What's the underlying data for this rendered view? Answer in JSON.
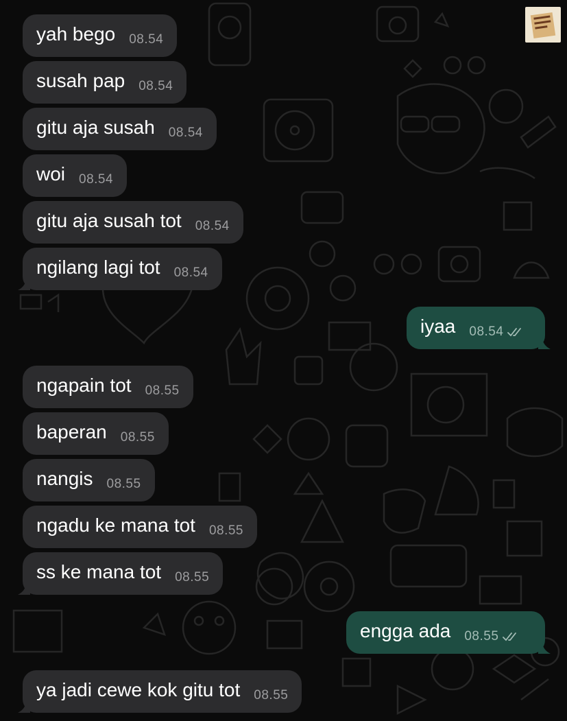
{
  "colors": {
    "background": "#0b0b0b",
    "incoming_bubble": "#2c2c2e",
    "outgoing_bubble": "#1e4d42",
    "timestamp_incoming": "#9d9d9f",
    "timestamp_outgoing": "#a4bdb6",
    "read_ticks": "#a4bdb6"
  },
  "corner_sticker": {
    "icon": "sticker-note-icon"
  },
  "messages": [
    {
      "text": "yah bego",
      "time": "08.54",
      "direction": "incoming"
    },
    {
      "text": "susah pap",
      "time": "08.54",
      "direction": "incoming"
    },
    {
      "text": "gitu aja susah",
      "time": "08.54",
      "direction": "incoming"
    },
    {
      "text": "woi",
      "time": "08.54",
      "direction": "incoming"
    },
    {
      "text": "gitu aja susah tot",
      "time": "08.54",
      "direction": "incoming"
    },
    {
      "text": "ngilang lagi tot",
      "time": "08.54",
      "direction": "incoming"
    },
    {
      "text": "iyaa",
      "time": "08.54",
      "direction": "outgoing",
      "status": "read"
    },
    {
      "text": "ngapain tot",
      "time": "08.55",
      "direction": "incoming"
    },
    {
      "text": "baperan",
      "time": "08.55",
      "direction": "incoming"
    },
    {
      "text": "nangis",
      "time": "08.55",
      "direction": "incoming"
    },
    {
      "text": "ngadu ke mana tot",
      "time": "08.55",
      "direction": "incoming"
    },
    {
      "text": "ss ke mana tot",
      "time": "08.55",
      "direction": "incoming"
    },
    {
      "text": "engga ada",
      "time": "08.55",
      "direction": "outgoing",
      "status": "read"
    },
    {
      "text": "ya jadi cewe kok gitu tot",
      "time": "08.55",
      "direction": "incoming"
    }
  ]
}
